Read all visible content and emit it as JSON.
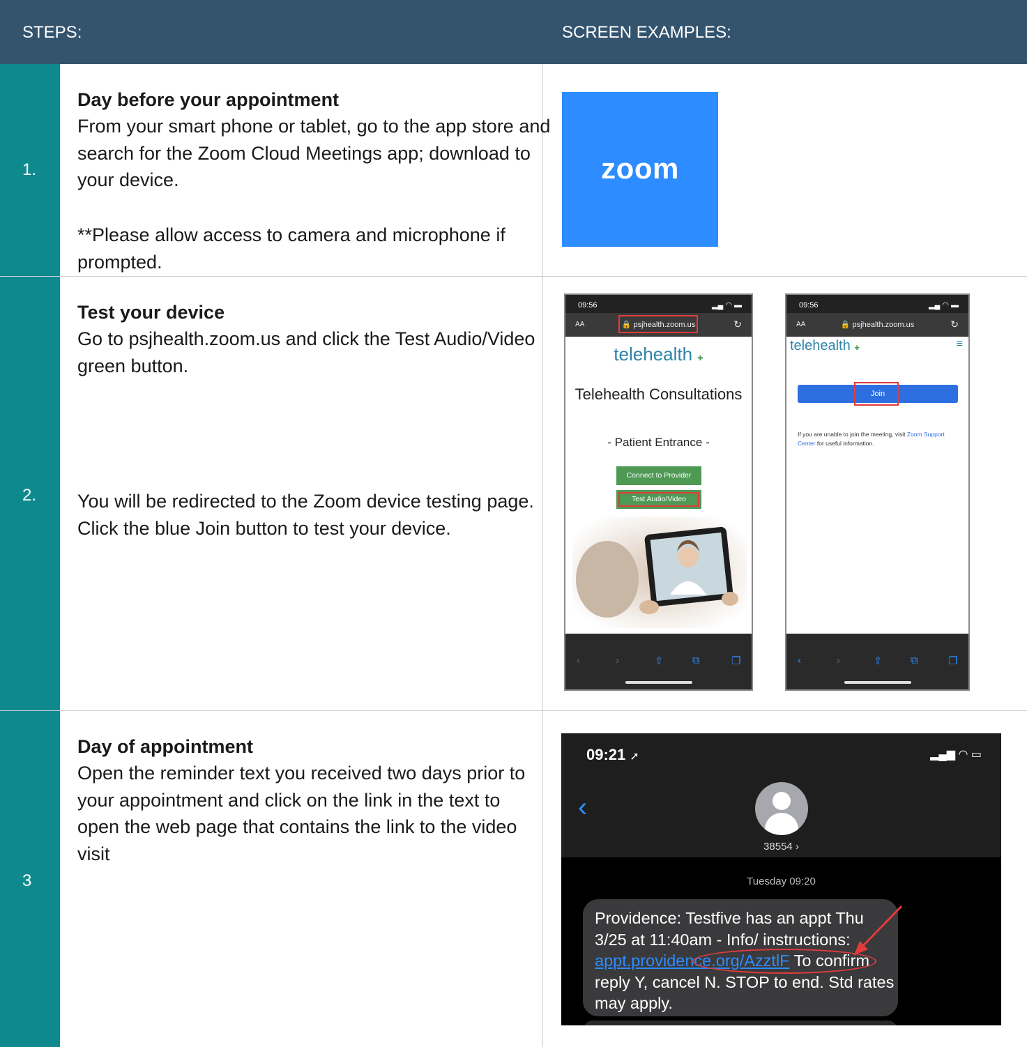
{
  "header": {
    "steps_label": "STEPS:",
    "examples_label": "SCREEN EXAMPLES:"
  },
  "steps": [
    {
      "number": "1.",
      "title": "Day before your appointment",
      "text": "From your smart phone or tablet, go to the app store and search for the Zoom Cloud Meetings app; download to your device.",
      "note": "**Please allow access to camera and microphone if prompted."
    },
    {
      "number": "2.",
      "title": "Test your device",
      "text": "Go to psjhealth.zoom.us and click the Test Audio/Video green button.",
      "text2": "You will be redirected to the Zoom device testing page. Click the blue Join button to test your device."
    },
    {
      "number": "3",
      "title": "Day of appointment",
      "text": "Open the reminder text you received two days prior to your appointment and click on the link in the text to open the web page that contains the link to the video visit"
    }
  ],
  "zoom_logo": {
    "wordmark": "zoom",
    "color": "#2d8cff"
  },
  "phone1": {
    "time": "09:56",
    "aa": "AA",
    "url": "psjhealth.zoom.us",
    "brand": "telehealth",
    "title": "Telehealth Consultations",
    "subtitle": "- Patient Entrance -",
    "connect_button": "Connect to Provider",
    "test_button": "Test Audio/Video"
  },
  "phone2": {
    "time": "09:56",
    "aa": "AA",
    "url": "psjhealth.zoom.us",
    "brand": "telehealth",
    "join_button": "Join",
    "info_prefix": "If you are unable to join the meeting, visit ",
    "info_link": "Zoom Support Center",
    "info_suffix": " for useful information."
  },
  "sms": {
    "time": "09:21",
    "contact": "38554",
    "date": "Tuesday 09:20",
    "msg_part1": "Providence: Testfive has an appt Thu 3/25 at 11:40am - Info/ instructions: ",
    "msg_link": "appt.providence.org/AzztlF",
    "msg_part2": " To confirm reply Y, cancel N. STOP to end. Std rates may apply."
  },
  "colors": {
    "header_bg": "#34546e",
    "number_col_bg": "#0e8a8f",
    "highlight_red": "#e23b3b"
  }
}
